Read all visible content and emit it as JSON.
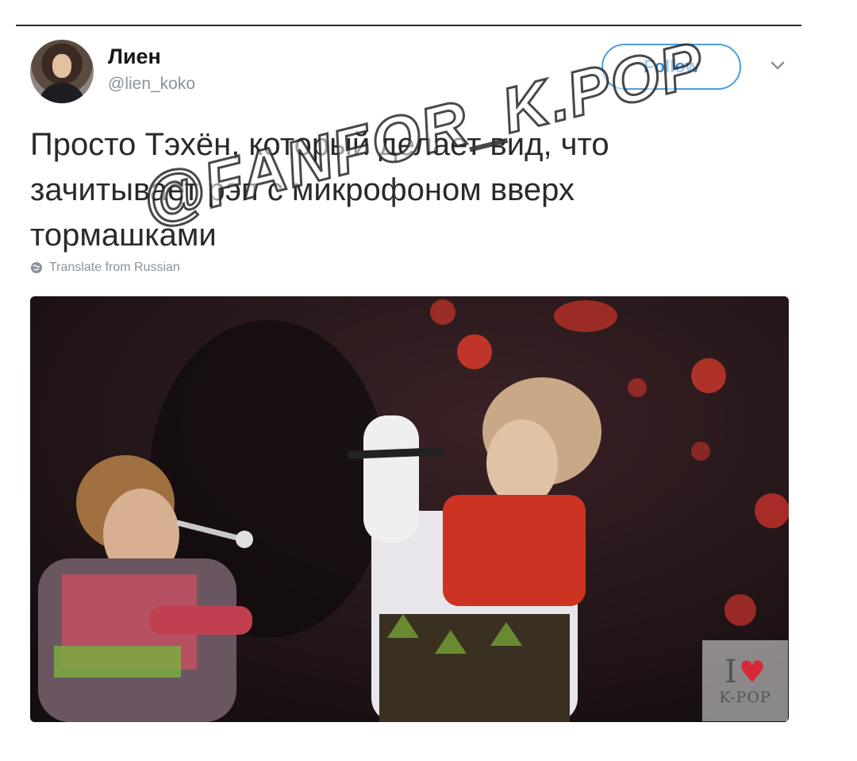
{
  "tweet": {
    "display_name": "Лиен",
    "handle": "@lien_koko",
    "follow_label": "Follow",
    "text": "Просто Тэхён, который делает вид, что зачитывает рэп с микрофоном вверх тормашками",
    "translate_label": "Translate from Russian"
  },
  "overlay": {
    "watermark": "@FANFOR_K.POP",
    "badge_letter": "I",
    "badge_heart": "♥",
    "badge_text": "K-POP"
  },
  "colors": {
    "accent": "#4a9ee5",
    "text": "#2a2a2a",
    "muted": "#8a9299"
  },
  "icons": {
    "caret": "chevron-down-icon",
    "translate": "globe-icon"
  }
}
